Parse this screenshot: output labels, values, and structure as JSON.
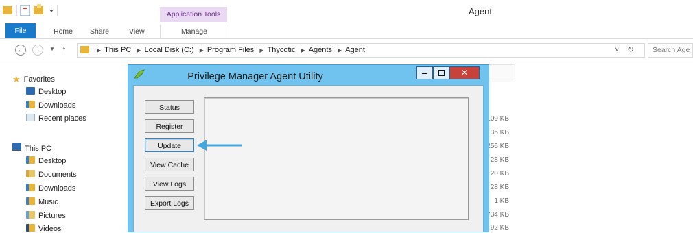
{
  "window": {
    "title": "Agent",
    "context_tab": "Application Tools"
  },
  "ribbon": {
    "tabs": [
      "File",
      "Home",
      "Share",
      "View"
    ],
    "manage_tab": "Manage"
  },
  "address": {
    "crumbs": [
      "This PC",
      "Local Disk (C:)",
      "Program Files",
      "Thycotic",
      "Agents",
      "Agent"
    ],
    "search_placeholder": "Search Age"
  },
  "nav": {
    "favorites": {
      "label": "Favorites",
      "items": [
        "Desktop",
        "Downloads",
        "Recent places"
      ]
    },
    "this_pc": {
      "label": "This PC",
      "items": [
        "Desktop",
        "Documents",
        "Downloads",
        "Music",
        "Pictures",
        "Videos"
      ]
    }
  },
  "file_sizes": [
    "109 KB",
    "135 KB",
    "256 KB",
    "28 KB",
    "20 KB",
    "28 KB",
    "1 KB",
    "734 KB",
    "92 KB"
  ],
  "dialog": {
    "title": "Privilege Manager Agent Utility",
    "buttons": [
      "Status",
      "Register",
      "Update",
      "View Cache",
      "View Logs",
      "Export Logs"
    ],
    "highlighted": "Update"
  },
  "colors": {
    "file_tab": "#1979ca",
    "context_tab_bg": "#e9d9f2",
    "dialog_frame": "#6fc3ee",
    "close_button": "#c7433a",
    "arrow": "#45a7e0"
  }
}
